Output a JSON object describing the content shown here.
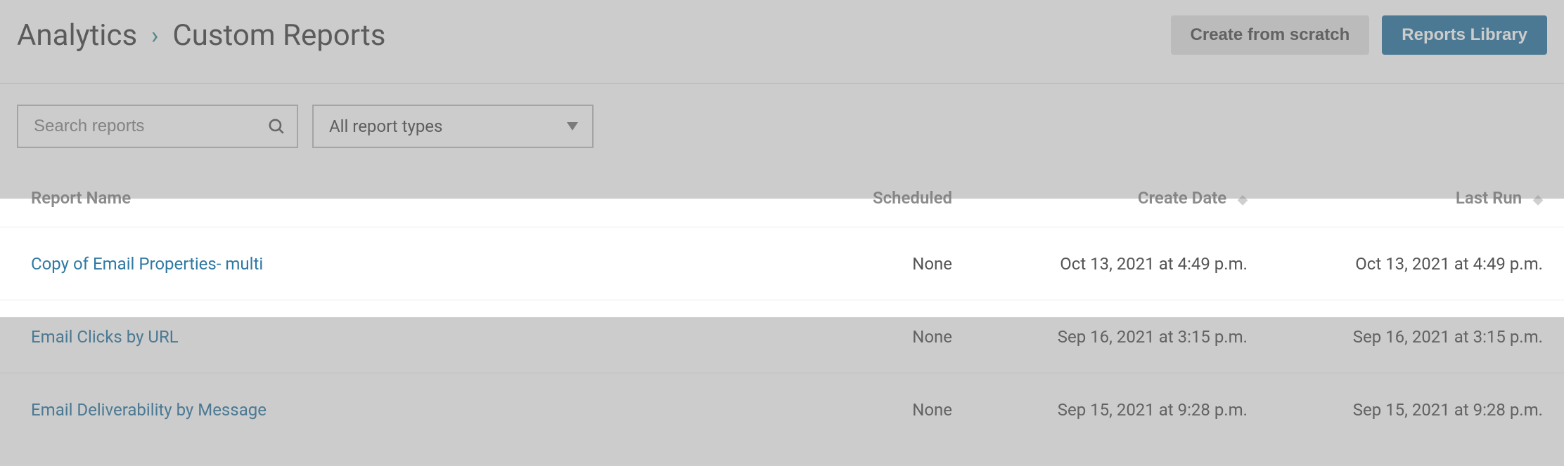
{
  "breadcrumb": {
    "root": "Analytics",
    "current": "Custom Reports"
  },
  "header": {
    "create_label": "Create from scratch",
    "library_label": "Reports Library"
  },
  "filters": {
    "search_placeholder": "Search reports",
    "type_selected": "All report types"
  },
  "table": {
    "columns": {
      "name": "Report Name",
      "scheduled": "Scheduled",
      "created": "Create Date",
      "last_run": "Last Run"
    },
    "rows": [
      {
        "name": "Copy of Email Properties- multi",
        "scheduled": "None",
        "created": "Oct 13, 2021 at 4:49 p.m.",
        "last_run": "Oct 13, 2021 at 4:49 p.m.",
        "highlight": true
      },
      {
        "name": "Email Clicks by URL",
        "scheduled": "None",
        "created": "Sep 16, 2021 at 3:15 p.m.",
        "last_run": "Sep 16, 2021 at 3:15 p.m.",
        "highlight": false
      },
      {
        "name": "Email Deliverability by Message",
        "scheduled": "None",
        "created": "Sep 15, 2021 at 9:28 p.m.",
        "last_run": "Sep 15, 2021 at 9:28 p.m.",
        "highlight": false
      }
    ]
  }
}
